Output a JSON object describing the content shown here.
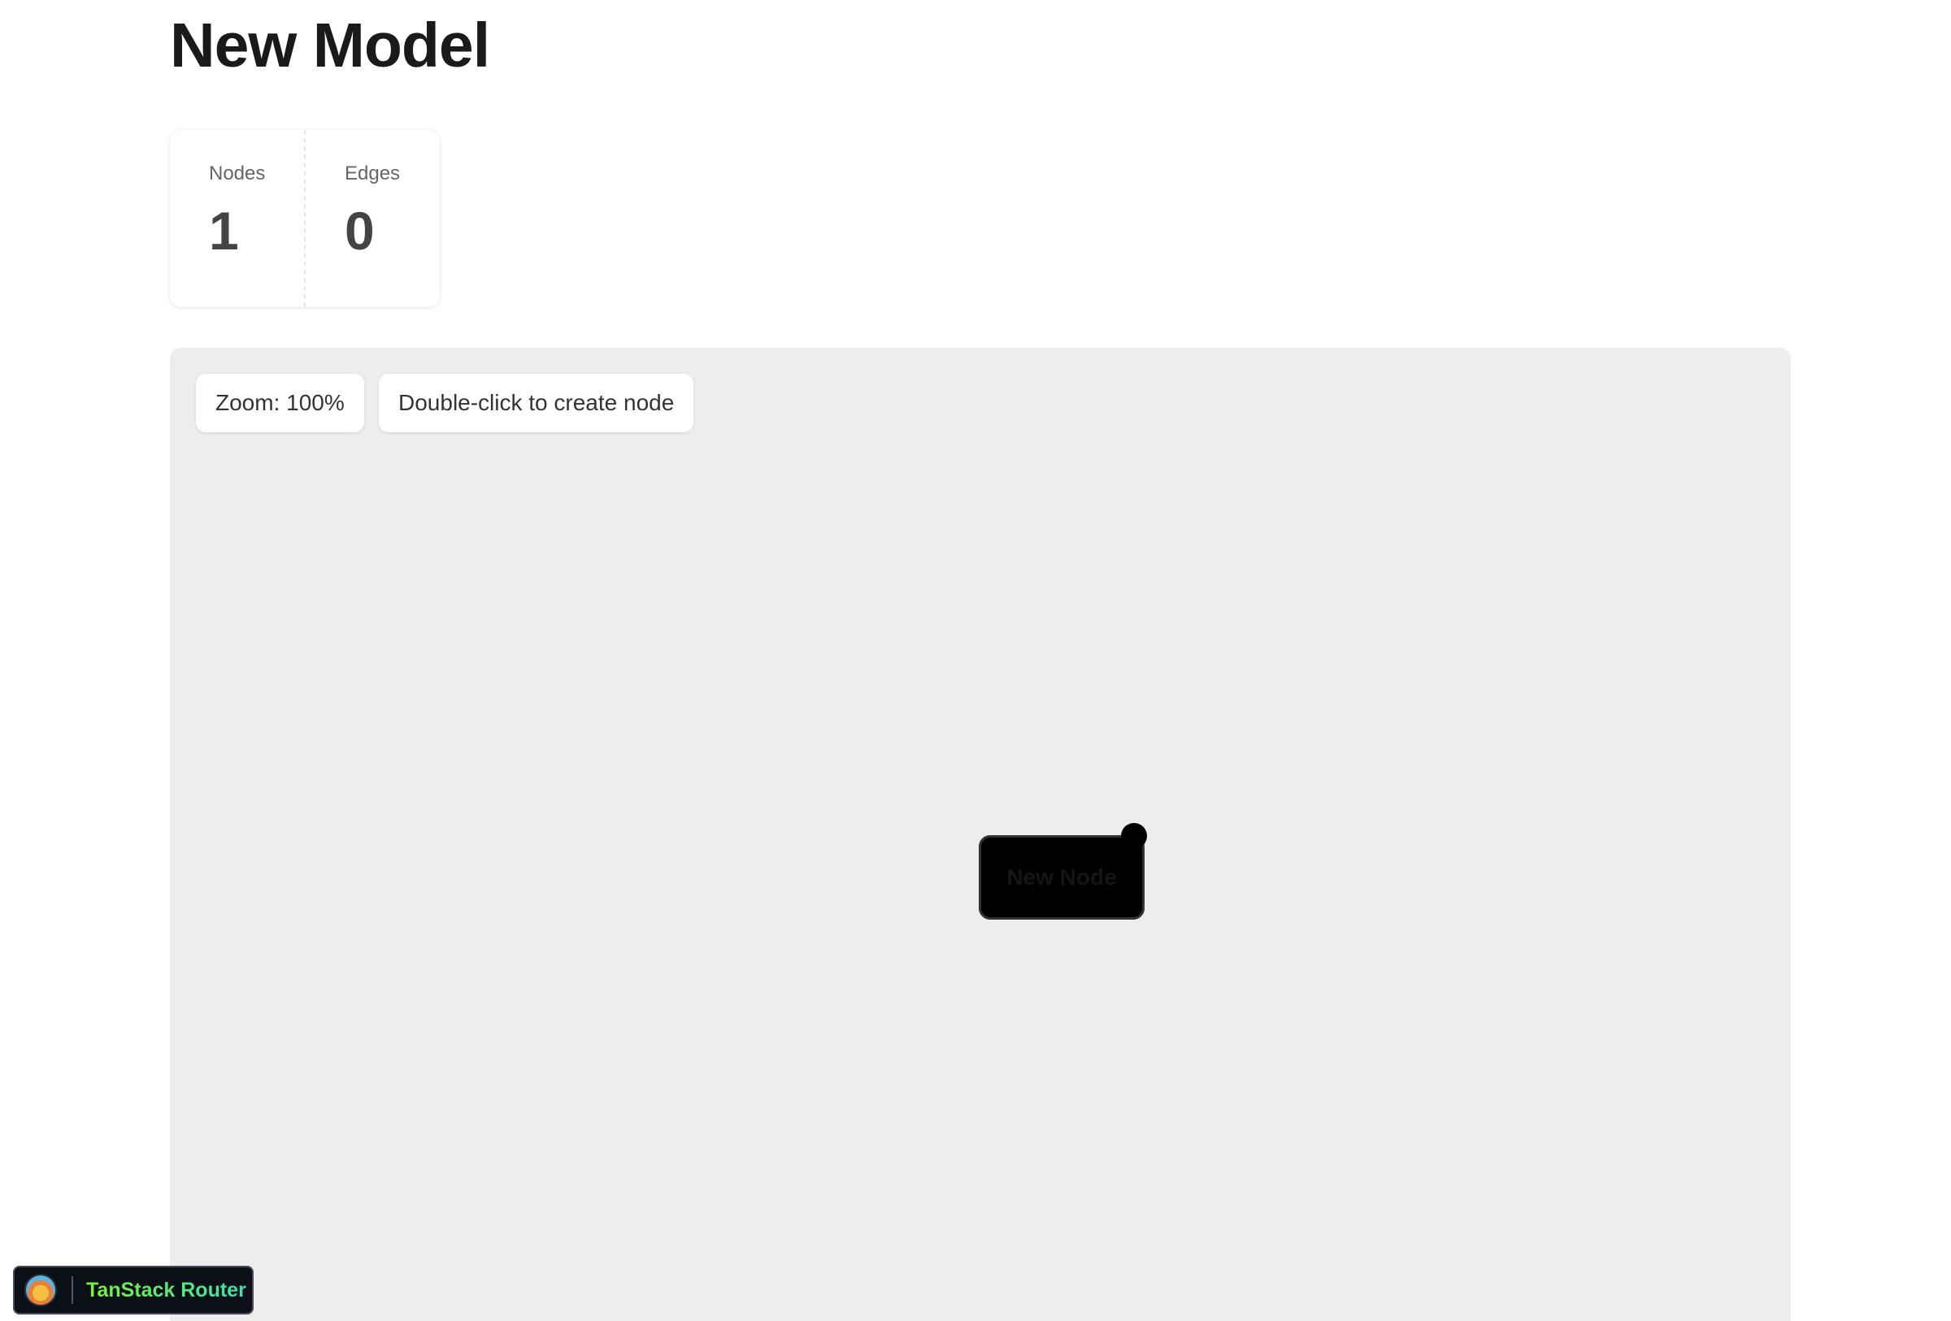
{
  "page": {
    "title": "New Model"
  },
  "stats": {
    "nodes_label": "Nodes",
    "nodes_value": "1",
    "edges_label": "Edges",
    "edges_value": "0"
  },
  "canvas": {
    "zoom_text": "Zoom: 100%",
    "hint_text": "Double-click to create node",
    "background_color": "#ededed"
  },
  "nodes": [
    {
      "label": "New Node",
      "fill": "#000000"
    }
  ],
  "devtools": {
    "label": "TanStack Router",
    "icon": "tanstack-logo-icon"
  }
}
